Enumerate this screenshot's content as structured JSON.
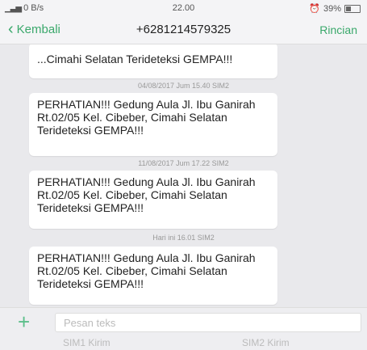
{
  "status_bar": {
    "left_text": "0 B/s",
    "time": "22.00",
    "battery": "39%"
  },
  "header": {
    "back_label": "Kembali",
    "contact": "+6281214579325",
    "details_label": "Rincian"
  },
  "messages": [
    {
      "text": "...Cimahi Selatan Terideteksi GEMPA!!!",
      "timestamp": ""
    },
    {
      "timestamp": "04/08/2017 Jum 15.40 SIM2",
      "text": "PERHATIAN!!! Gedung Aula Jl. Ibu Ganirah Rt.02/05 Kel. Cibeber, Cimahi Selatan Terideteksi GEMPA!!!"
    },
    {
      "timestamp": "11/08/2017 Jum 17.22 SIM2",
      "text": "PERHATIAN!!! Gedung Aula Jl. Ibu Ganirah Rt.02/05 Kel. Cibeber, Cimahi Selatan Terideteksi GEMPA!!!"
    },
    {
      "timestamp": "Hari ini 16.01 SIM2",
      "text": "PERHATIAN!!! Gedung Aula Jl. Ibu Ganirah Rt.02/05 Kel. Cibeber, Cimahi Selatan Terideteksi GEMPA!!!"
    }
  ],
  "composer": {
    "placeholder": "Pesan teks",
    "sim1_label": "SIM1 Kirim",
    "sim2_label": "SIM2 Kirim"
  },
  "colors": {
    "accent": "#3aa86b",
    "bubble": "#ffffff",
    "background": "#e9e9ec"
  }
}
